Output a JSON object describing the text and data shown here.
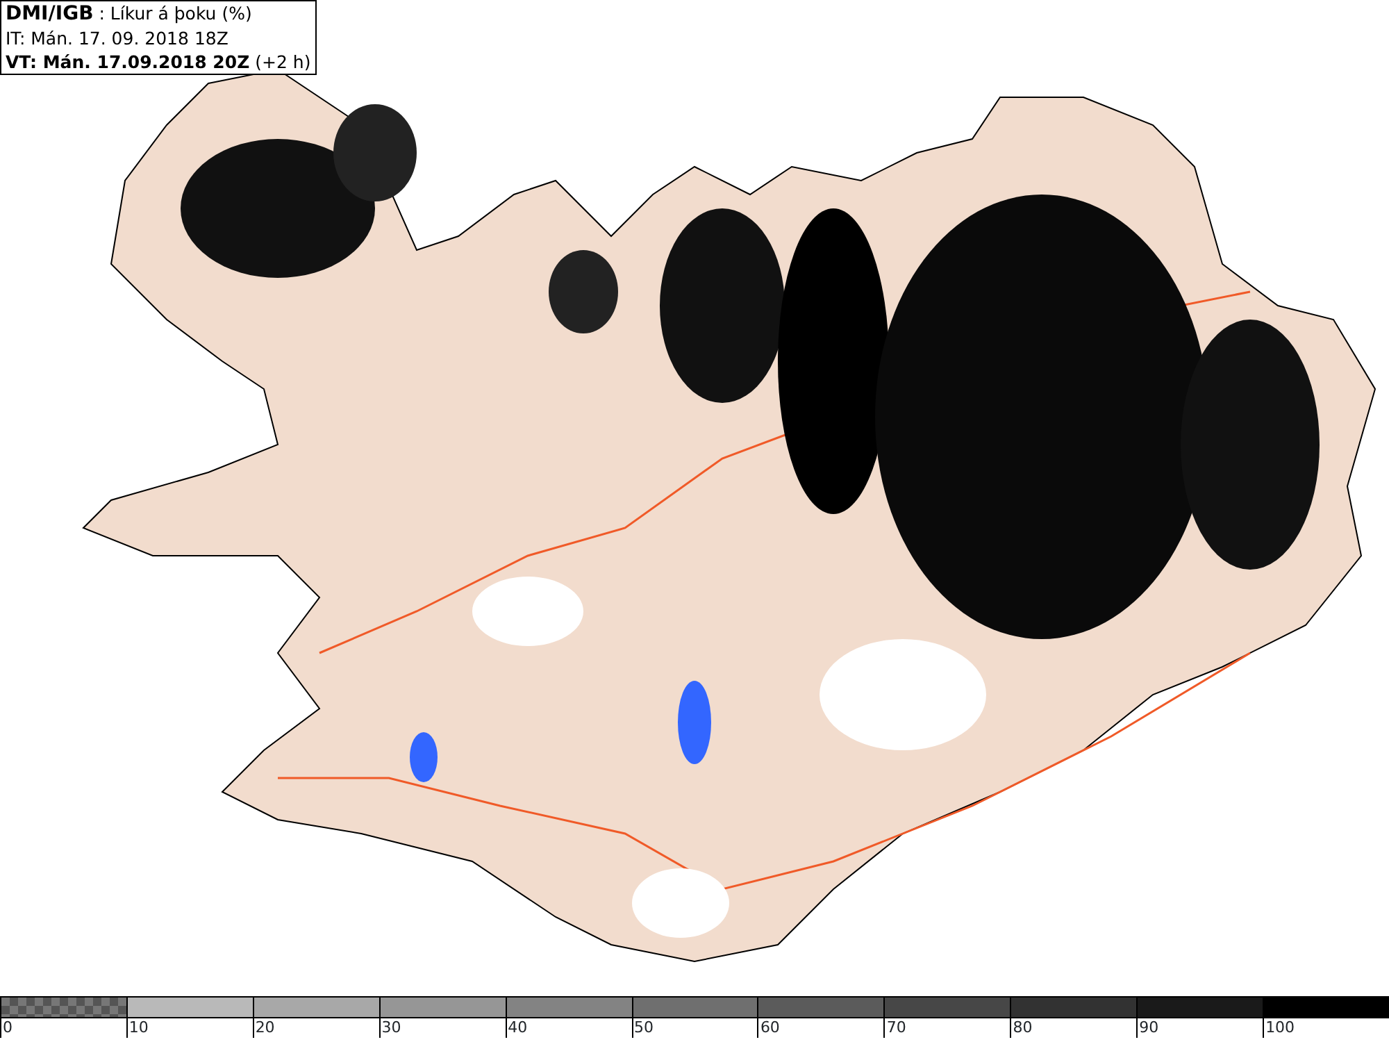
{
  "header": {
    "title": "**DMI/IGB** : Líkur á þoku (%)",
    "issued": "IT: Mán. 17. 09. 2018 18Z",
    "valid": "**VT: Mán. 17.09.2018 20Z** (+2 h)"
  },
  "legend": {
    "segments": [
      {
        "label": "0",
        "kind": "checkered",
        "color": "#777777"
      },
      {
        "label": "10",
        "kind": "solid",
        "color": "#b9b9b9"
      },
      {
        "label": "20",
        "kind": "solid",
        "color": "#a8a8a8"
      },
      {
        "label": "30",
        "kind": "solid",
        "color": "#969696"
      },
      {
        "label": "40",
        "kind": "solid",
        "color": "#838383"
      },
      {
        "label": "50",
        "kind": "solid",
        "color": "#6f6f6f"
      },
      {
        "label": "60",
        "kind": "solid",
        "color": "#5b5b5b"
      },
      {
        "label": "70",
        "kind": "solid",
        "color": "#474747"
      },
      {
        "label": "80",
        "kind": "solid",
        "color": "#323232"
      },
      {
        "label": "90",
        "kind": "solid",
        "color": "#1a1a1a"
      },
      {
        "label": "100",
        "kind": "solid",
        "color": "#000000"
      }
    ]
  }
}
